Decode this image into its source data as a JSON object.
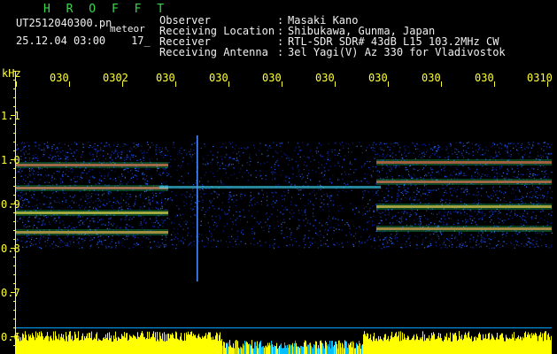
{
  "header": {
    "title": "H R O F F T",
    "filename": "UT2512040300.pn",
    "meteor_label": "meteor",
    "datetime": "25.12.04 03:00",
    "counter": "17_"
  },
  "info": [
    {
      "key": "Observer",
      "value": "Masaki Kano"
    },
    {
      "key": "Receiving Location",
      "value": "Shibukawa, Gunma, Japan"
    },
    {
      "key": "Receiver",
      "value": "RTL-SDR SDR# 43dB L15 103.2MHz CW"
    },
    {
      "key": "Receiving Antenna",
      "value": "3el Yagi(V) Az 330 for Vladivostok"
    }
  ],
  "axis": {
    "y_unit": "kHz",
    "y_ticks": [
      "1.1",
      "1.0",
      "0.9",
      "0.8",
      "0.7",
      "0.6"
    ],
    "x_ticks": [
      "030",
      "0302",
      "030",
      "030",
      "030",
      "030",
      "030",
      "030",
      "030",
      "0310"
    ]
  },
  "colors": {
    "background": "#000000",
    "title": "#39d84b",
    "text": "#f0f0f0",
    "axis": "#ffff33",
    "signal_floor": "#ffff00",
    "signal_gap": "#00bfff"
  }
}
